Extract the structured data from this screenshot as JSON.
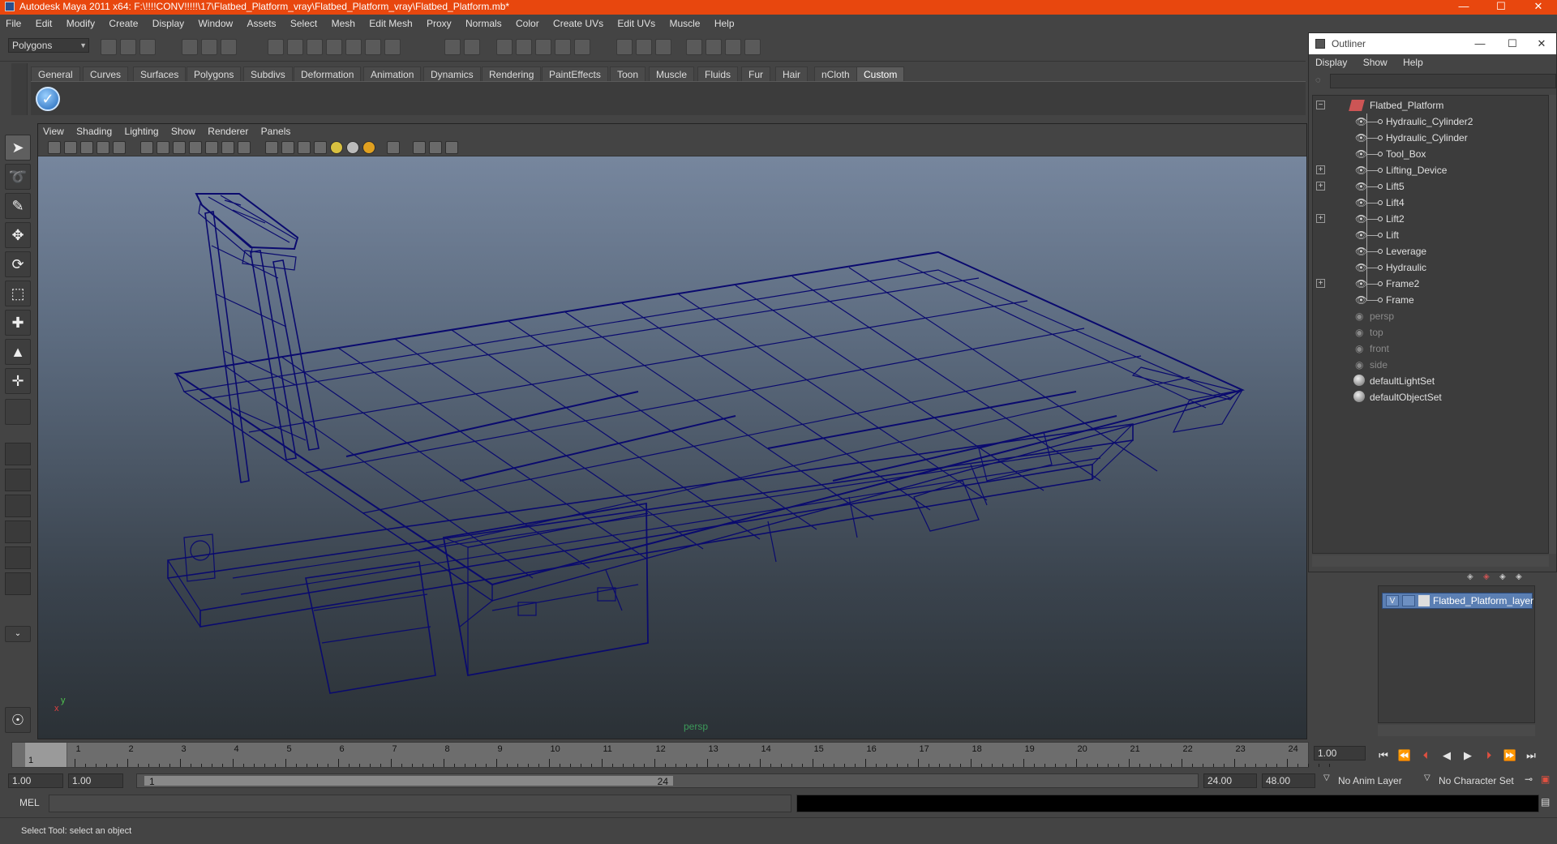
{
  "window": {
    "title": "Autodesk Maya 2011 x64: F:\\!!!!CONV!!!!!\\17\\Flatbed_Platform_vray\\Flatbed_Platform_vray\\Flatbed_Platform.mb*",
    "minimize": "—",
    "maximize": "☐",
    "close": "✕"
  },
  "menubar": [
    "File",
    "Edit",
    "Modify",
    "Create",
    "Display",
    "Window",
    "Assets",
    "Select",
    "Mesh",
    "Edit Mesh",
    "Proxy",
    "Normals",
    "Color",
    "Create UVs",
    "Edit UVs",
    "Muscle",
    "Help"
  ],
  "statusline": {
    "mode": "Polygons"
  },
  "shelf": {
    "tabs": [
      "General",
      "Curves",
      "Surfaces",
      "Polygons",
      "Subdivs",
      "Deformation",
      "Animation",
      "Dynamics",
      "Rendering",
      "PaintEffects",
      "Toon",
      "Muscle",
      "Fluids",
      "Fur",
      "Hair",
      "nCloth",
      "Custom"
    ],
    "active_tab": "Custom"
  },
  "viewport": {
    "menu": [
      "View",
      "Shading",
      "Lighting",
      "Show",
      "Renderer",
      "Panels"
    ],
    "camera_label": "persp",
    "axis_y": "y",
    "axis_x": "x"
  },
  "timeline": {
    "ticks": [
      "1",
      "2",
      "3",
      "4",
      "5",
      "6",
      "7",
      "8",
      "9",
      "10",
      "11",
      "12",
      "13",
      "14",
      "15",
      "16",
      "17",
      "18",
      "19",
      "20",
      "21",
      "22",
      "23",
      "24"
    ],
    "current_frame_label": "1",
    "current_frame_field": "1.00"
  },
  "range": {
    "start_time": "1.00",
    "playback_start": "1.00",
    "range_start_label": "1",
    "range_end_label": "24",
    "playback_end": "24.00",
    "end_time": "48.00",
    "anim_layer": "No Anim Layer",
    "character_set": "No Character Set"
  },
  "commandline": {
    "label": "MEL"
  },
  "helpline": {
    "text": "Select Tool: select an object"
  },
  "outliner": {
    "title": "Outliner",
    "menu": [
      "Display",
      "Show",
      "Help"
    ],
    "root": "Flatbed_Platform",
    "children": [
      {
        "name": "Hydraulic_Cylinder2",
        "expandable": false
      },
      {
        "name": "Hydraulic_Cylinder",
        "expandable": false
      },
      {
        "name": "Tool_Box",
        "expandable": false
      },
      {
        "name": "Lifting_Device",
        "expandable": true
      },
      {
        "name": "Lift5",
        "expandable": true
      },
      {
        "name": "Lift4",
        "expandable": false
      },
      {
        "name": "Lift2",
        "expandable": true
      },
      {
        "name": "Lift",
        "expandable": false
      },
      {
        "name": "Leverage",
        "expandable": false
      },
      {
        "name": "Hydraulic",
        "expandable": false
      },
      {
        "name": "Frame2",
        "expandable": true
      },
      {
        "name": "Frame",
        "expandable": false
      }
    ],
    "cameras": [
      "persp",
      "top",
      "front",
      "side"
    ],
    "sets": [
      "defaultLightSet",
      "defaultObjectSet"
    ]
  },
  "layers": {
    "name": "Flatbed_Platform_layer",
    "visible_flag": "V"
  },
  "colors": {
    "titlebar": "#e8470e",
    "wireframe": "#0a0a6e",
    "layer_selected": "#5b7fb3"
  }
}
